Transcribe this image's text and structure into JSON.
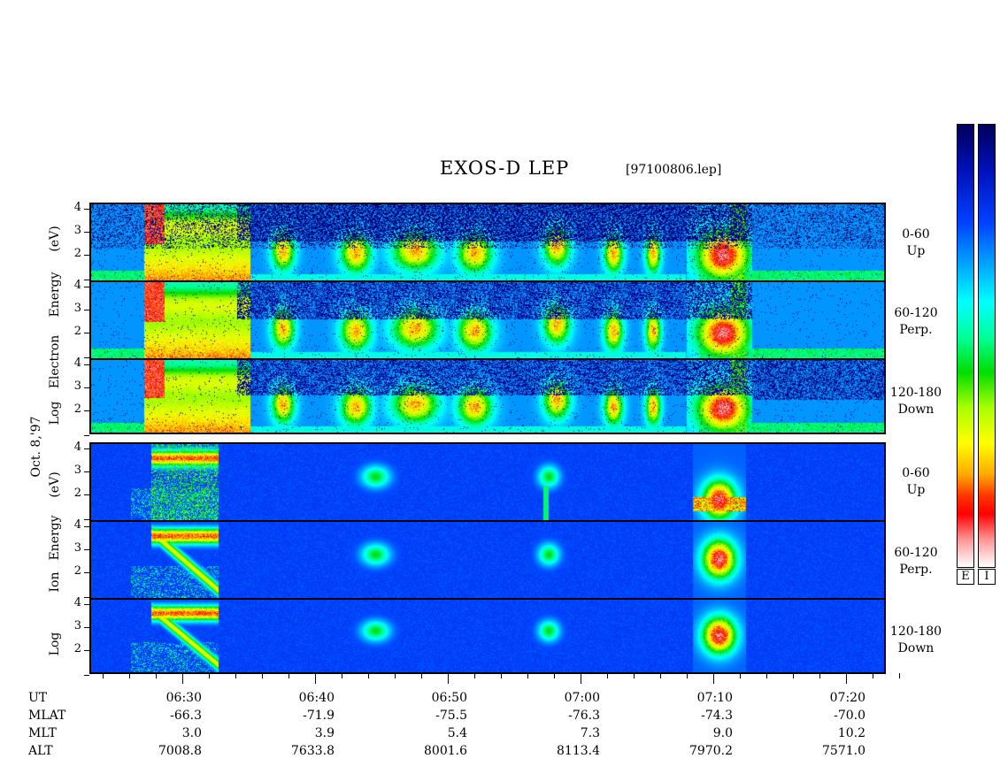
{
  "chart_data": {
    "type": "heatmap",
    "title": "EXOS-D LEP",
    "file_label": "[97100806.lep]",
    "date_label": "Oct. 8,'97",
    "x_range_ut": [
      "06:23",
      "07:23"
    ],
    "x_ticks": [
      "06:30",
      "06:40",
      "06:50",
      "07:00",
      "07:10",
      "07:20"
    ],
    "y_range_log_ev": [
      0.9,
      4.2
    ],
    "y_ticks": [
      "4",
      "3",
      "2"
    ],
    "species": [
      {
        "name": "Electron",
        "ylabel": [
          "Log",
          "Electron",
          "Energy",
          "(eV)"
        ],
        "channels": [
          {
            "pitch": "0-60",
            "dir": "Up"
          },
          {
            "pitch": "60-120",
            "dir": "Perp."
          },
          {
            "pitch": "120-180",
            "dir": "Down"
          }
        ]
      },
      {
        "name": "Ion",
        "ylabel": [
          "Log",
          "Ion",
          "Energy",
          "(eV)"
        ],
        "channels": [
          {
            "pitch": "0-60",
            "dir": "Up"
          },
          {
            "pitch": "60-120",
            "dir": "Perp."
          },
          {
            "pitch": "120-180",
            "dir": "Down"
          }
        ]
      }
    ],
    "ephemeris": {
      "rows": [
        "UT",
        "MLAT",
        "MLT",
        "ALT"
      ],
      "columns": [
        {
          "ut": "06:30",
          "mlat": "-66.3",
          "mlt": "3.0",
          "alt": "7008.8"
        },
        {
          "ut": "06:40",
          "mlat": "-71.9",
          "mlt": "3.9",
          "alt": "7633.8"
        },
        {
          "ut": "06:50",
          "mlat": "-75.5",
          "mlt": "5.4",
          "alt": "8001.6"
        },
        {
          "ut": "07:00",
          "mlat": "-76.3",
          "mlt": "7.3",
          "alt": "8113.4"
        },
        {
          "ut": "07:10",
          "mlat": "-74.3",
          "mlt": "9.0",
          "alt": "7970.2"
        },
        {
          "ut": "07:20",
          "mlat": "-70.0",
          "mlt": "10.2",
          "alt": "7571.0"
        }
      ]
    },
    "colorbars": [
      "E",
      "I"
    ]
  }
}
